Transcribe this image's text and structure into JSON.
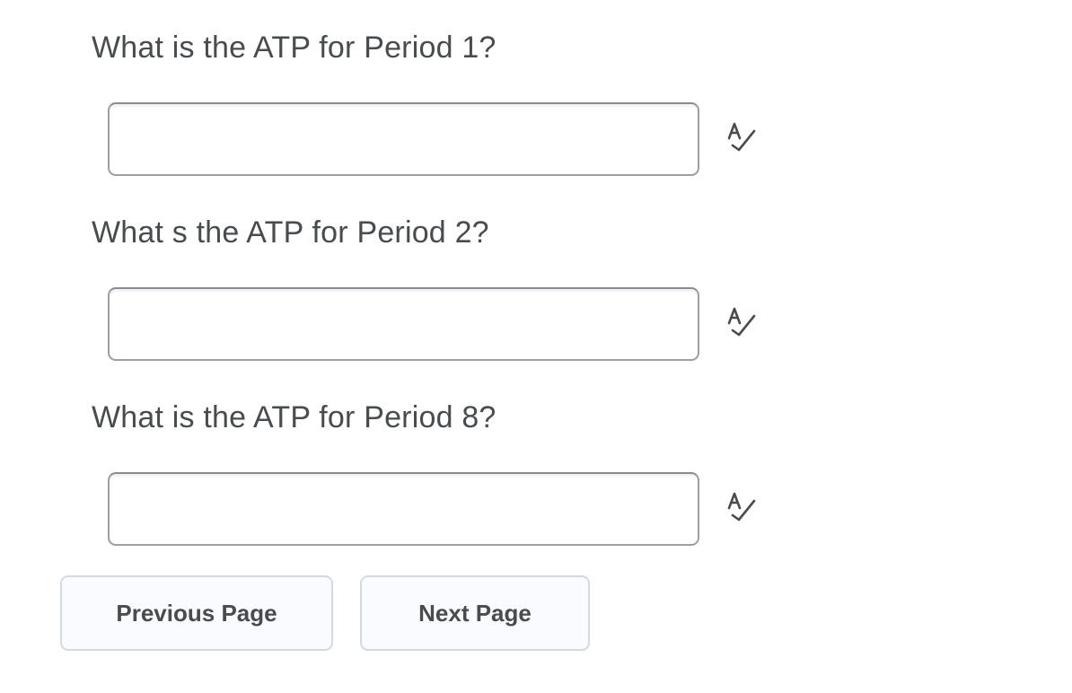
{
  "questions": [
    {
      "label": "What is the ATP for Period 1?",
      "answer_value": "",
      "spellcheck_icon": "spellcheck-icon"
    },
    {
      "label": "What s the ATP for Period 2?",
      "answer_value": "",
      "spellcheck_icon": "spellcheck-icon"
    },
    {
      "label": "What is the ATP for Period 8?",
      "answer_value": "",
      "spellcheck_icon": "spellcheck-icon"
    }
  ],
  "navigation": {
    "previous_label": "Previous Page",
    "next_label": "Next Page"
  },
  "colors": {
    "text": "#494c4e",
    "input_border": "#9c9fa2",
    "button_background": "#f9fbff",
    "button_border": "#d3d9e3"
  }
}
